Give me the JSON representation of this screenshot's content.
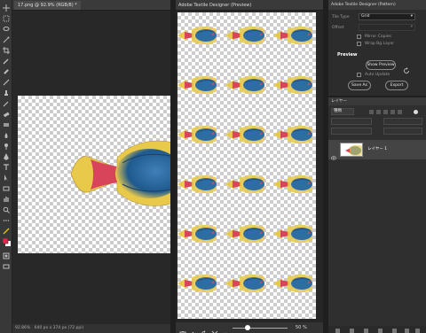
{
  "document": {
    "tab_title": "17.png @ 92.9% (RGB/8) *",
    "status_zoom": "92.86%",
    "status_info": "640 px x 374 px (72 ppi)"
  },
  "preview": {
    "title": "Adobe Textile Designer (Preview)",
    "zoom_value": "50 %"
  },
  "pattern_panel": {
    "title": "Adobe Textile Designer (Pattern)",
    "tile_type_label": "Tile Type",
    "tile_type_value": "Grid",
    "offset_label": "Offset",
    "mirror_copies_label": "Mirror Copies",
    "wrap_bg_label": "Wrap Bg Layer",
    "preview_section": "Preview",
    "show_preview_button": "Show Preview",
    "auto_update_label": "Auto Update",
    "save_as_button": "Save As",
    "export_button": "Export"
  },
  "layers_panel": {
    "title": "レイヤー",
    "filter_kind": "種類",
    "layer_name": "レイヤー 1"
  },
  "icons": {
    "document_toolbar": [
      "move-icon",
      "marquee-icon",
      "lasso-icon",
      "magic-wand-icon",
      "crop-icon",
      "eyedropper-icon",
      "healing-brush-icon",
      "brush-icon",
      "clone-stamp-icon",
      "history-brush-icon",
      "eraser-icon",
      "gradient-icon",
      "blur-icon",
      "dodge-icon",
      "pen-icon",
      "type-icon",
      "path-selection-icon",
      "rectangle-icon",
      "hand-icon",
      "zoom-icon",
      "more-tools-icon",
      "edit-toolbar-icon",
      "color-swatch-icon",
      "quick-mask-icon",
      "screen-mode-icon"
    ],
    "preview_footer": [
      "preview-settings-icon",
      "link-icon",
      "refresh-icon",
      "zoom-out-icon",
      "zoom-in-icon"
    ]
  },
  "colors": {
    "fish_body": "#2e6da4",
    "fish_fin": "#e8c94a",
    "fish_tail": "#d8445a",
    "foreground": "#e8254a",
    "background": "#ffffff"
  }
}
